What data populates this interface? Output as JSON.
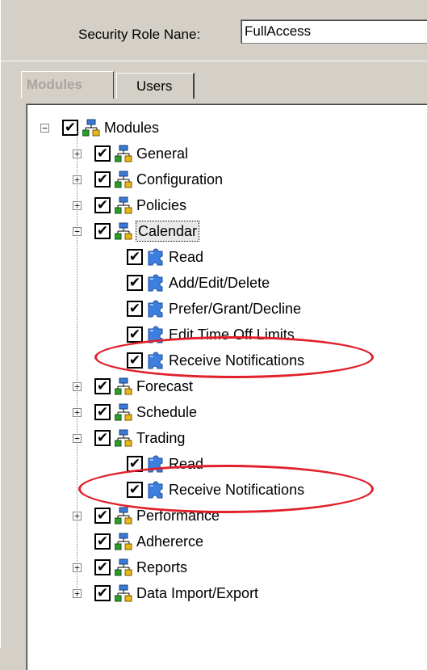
{
  "form": {
    "role_label": "Security Role Nane:",
    "role_value": "FullAccess"
  },
  "tabs": [
    {
      "label": "Modules",
      "active": true
    },
    {
      "label": "Users",
      "active": false
    }
  ],
  "tree": {
    "root": {
      "label": "Modules",
      "checked": true,
      "expanded": true
    },
    "modules": [
      {
        "label": "General",
        "checked": true,
        "expanded": false
      },
      {
        "label": "Configuration",
        "checked": true,
        "expanded": false
      },
      {
        "label": "Policies",
        "checked": true,
        "expanded": false
      },
      {
        "label": "Calendar",
        "checked": true,
        "expanded": true,
        "selected": true,
        "children": [
          "Read",
          "Add/Edit/Delete",
          "Prefer/Grant/Decline",
          "Edit Time Off Limits",
          "Receive Notifications"
        ]
      },
      {
        "label": "Forecast",
        "checked": true,
        "expanded": false
      },
      {
        "label": "Schedule",
        "checked": true,
        "expanded": false
      },
      {
        "label": "Trading",
        "checked": true,
        "expanded": true,
        "children": [
          "Read",
          "Receive Notifications"
        ]
      },
      {
        "label": "Performance",
        "checked": true,
        "expanded": false
      },
      {
        "label": "Adhererce",
        "checked": true,
        "expanded": null
      },
      {
        "label": "Reports",
        "checked": true,
        "expanded": false
      },
      {
        "label": "Data Import/Export",
        "checked": true,
        "expanded": false
      }
    ]
  },
  "icons": {
    "module": "module-network-icon",
    "permission": "puzzle-piece-icon",
    "check": "✔"
  },
  "colors": {
    "highlight_oval": "#e0202a",
    "window_bg": "#d4d0c8",
    "module_icon_blue": "#3a7bd5",
    "module_icon_green": "#2e9b2e",
    "module_icon_yellow": "#e8b818",
    "puzzle_blue": "#3c7fe0"
  }
}
